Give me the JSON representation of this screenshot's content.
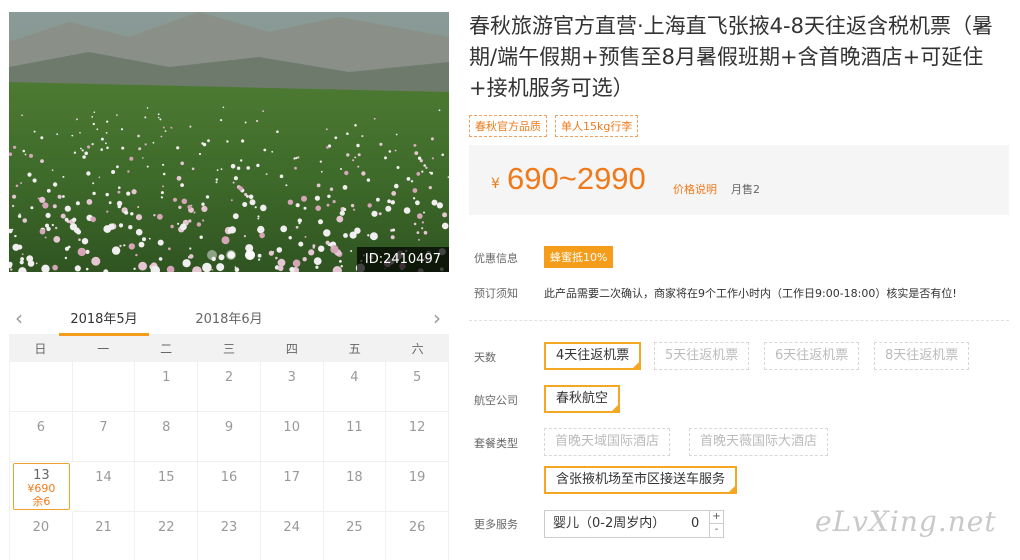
{
  "hero": {
    "photo_id": "ID:2410497",
    "dots": 3,
    "active_dot": 3
  },
  "calendar": {
    "prev_icon": "‹",
    "next_icon": "›",
    "months": [
      "2018年5月",
      "2018年6月"
    ],
    "weekdays": [
      "日",
      "一",
      "二",
      "三",
      "四",
      "五",
      "六"
    ],
    "week1": [
      "",
      "",
      "1",
      "2",
      "3",
      "4",
      "5"
    ],
    "week2": [
      "6",
      "7",
      "8",
      "9",
      "10",
      "11",
      "12"
    ],
    "selected": {
      "day": "13",
      "price": "¥690",
      "stock": "余6"
    },
    "week3": [
      "14",
      "15",
      "16",
      "17",
      "18",
      "19"
    ],
    "week4": [
      "20",
      "21",
      "22",
      "23",
      "24",
      "25",
      "26"
    ]
  },
  "product": {
    "title": "春秋旅游官方直营·上海直飞张掖4-8天往返含税机票（暑期/端午假期+预售至8月暑假班期+含首晚酒店+可延住+接机服务可选）",
    "tags": [
      "春秋官方品质",
      "单人15kg行李"
    ],
    "price_currency": "¥",
    "price_range": "690~2990",
    "price_explain": "价格说明",
    "monthly_sales": "月售2"
  },
  "info": {
    "promo_label": "优惠信息",
    "promo_badge": "蜂蜜抵10%",
    "booking_label": "预订须知",
    "booking_text": "此产品需要二次确认，商家将在9个工作小时内（工作日9:00-18:00）核实是否有位!"
  },
  "options": {
    "days_label": "天数",
    "days": [
      "4天往返机票",
      "5天往返机票",
      "6天往返机票",
      "8天往返机票"
    ],
    "airline_label": "航空公司",
    "airline": "春秋航空",
    "package_label": "套餐类型",
    "packages": [
      "首晚天域国际酒店",
      "首晚天薇国际大酒店",
      "含张掖机场至市区接送车服务"
    ],
    "extra_label": "更多服务",
    "extra_item": "婴儿（0-2周岁内）",
    "extra_qty": "0",
    "plus": "+",
    "minus": "-"
  },
  "watermark": "eLvXing.net",
  "colors": {
    "accent": "#f59c1a",
    "price": "#f07a1a"
  }
}
